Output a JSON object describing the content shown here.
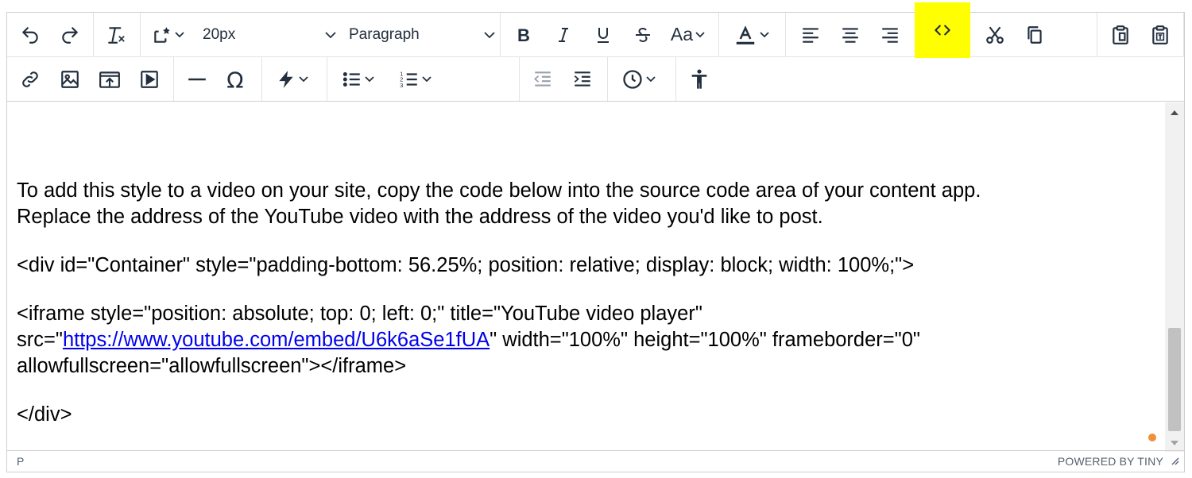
{
  "toolbar": {
    "font_size": "20px",
    "block_format": "Paragraph",
    "font_style_label": "Aa"
  },
  "content": {
    "para1_line1": "To add this style to a video on your site, copy the code below into the source code area of your content app.",
    "para1_line2": "Replace the address of the YouTube video with the address of the video you'd like to post.",
    "code_div_open": "<div id=\"Container\" style=\"padding-bottom: 56.25%; position: relative; display: block; width: 100%;\">",
    "iframe_line1": "<iframe style=\"position: absolute; top: 0; left: 0;\" title=\"YouTube video player\"",
    "iframe_src_prefix": "src=\"",
    "iframe_link": "https://www.youtube.com/embed/U6k6aSe1fUA",
    "iframe_src_suffix": "\" width=\"100%\" height=\"100%\" frameborder=\"0\"",
    "iframe_line3": "allowfullscreen=\"allowfullscreen\"></iframe>",
    "code_div_close": "</div>"
  },
  "statusbar": {
    "path": "P",
    "powered_by": "POWERED BY TINY"
  },
  "colors": {
    "highlight": "#ffff00",
    "icon": "#222f3e",
    "link": "#0000ee",
    "dot": "#f08f3c"
  }
}
